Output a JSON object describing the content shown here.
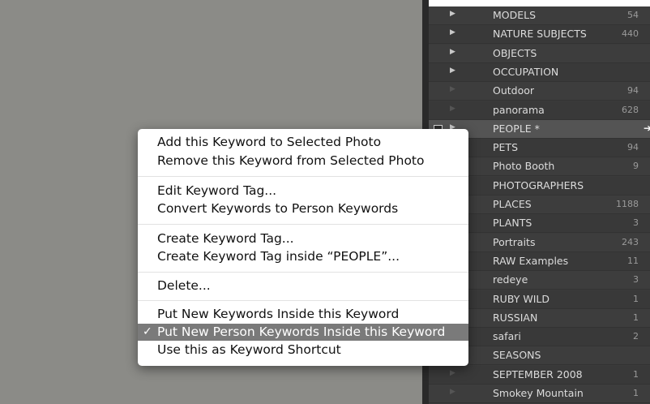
{
  "keyword_panel": {
    "rows": [
      {
        "name": "MODELS",
        "count": "54",
        "expandable": true
      },
      {
        "name": "NATURE SUBJECTS",
        "count": "440",
        "expandable": true
      },
      {
        "name": "OBJECTS",
        "count": "",
        "expandable": true
      },
      {
        "name": "OCCUPATION",
        "count": "",
        "expandable": true
      },
      {
        "name": "Outdoor",
        "count": "94",
        "expandable": false
      },
      {
        "name": "panorama",
        "count": "628",
        "expandable": false
      },
      {
        "name": "PEOPLE  *",
        "count": "",
        "expandable": true,
        "selected": true
      },
      {
        "name": "PETS",
        "count": "94",
        "expandable": false
      },
      {
        "name": "Photo Booth",
        "count": "9",
        "expandable": false
      },
      {
        "name": "PHOTOGRAPHERS",
        "count": "",
        "expandable": false
      },
      {
        "name": "PLACES",
        "count": "1188",
        "expandable": false
      },
      {
        "name": "PLANTS",
        "count": "3",
        "expandable": false
      },
      {
        "name": "Portraits",
        "count": "243",
        "expandable": false
      },
      {
        "name": "RAW Examples",
        "count": "11",
        "expandable": false
      },
      {
        "name": "redeye",
        "count": "3",
        "expandable": false
      },
      {
        "name": "RUBY WILD",
        "count": "1",
        "expandable": false
      },
      {
        "name": "RUSSIAN",
        "count": "1",
        "expandable": false
      },
      {
        "name": "safari",
        "count": "2",
        "expandable": false
      },
      {
        "name": "SEASONS",
        "count": "",
        "expandable": false
      },
      {
        "name": "SEPTEMBER 2008",
        "count": "1",
        "expandable": false
      },
      {
        "name": "Smokey Mountain",
        "count": "1",
        "expandable": false
      }
    ]
  },
  "context_menu": {
    "add_to_selected": "Add this Keyword to Selected Photo",
    "remove_from_selected": "Remove this Keyword from Selected Photo",
    "edit_tag": "Edit Keyword Tag...",
    "convert_to_person": "Convert Keywords to Person Keywords",
    "create_tag": "Create Keyword Tag...",
    "create_tag_inside": "Create Keyword Tag inside “PEOPLE”...",
    "delete": "Delete...",
    "put_new_inside": "Put New Keywords Inside this Keyword",
    "put_new_person_inside": "Put New Person Keywords Inside this Keyword",
    "use_as_shortcut": "Use this as Keyword Shortcut",
    "checkmark": "✓"
  },
  "colors": {
    "canvas": "#8b8b87",
    "panel": "#3b3b3b",
    "menu_highlight": "#7a7a7a"
  }
}
